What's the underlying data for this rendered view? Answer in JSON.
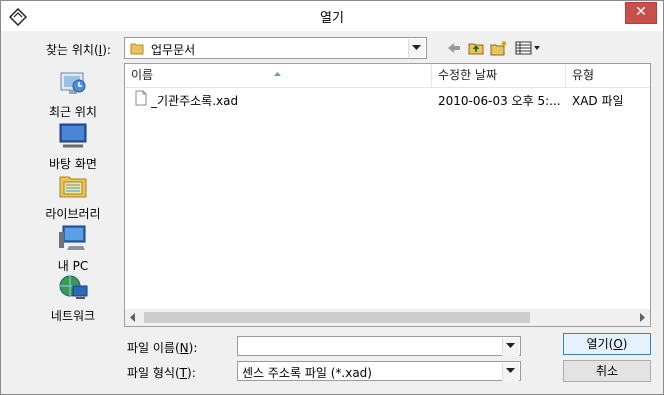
{
  "window": {
    "title": "열기"
  },
  "lookin": {
    "label": "찾는 위치(I):",
    "value": "업무문서"
  },
  "places": [
    {
      "label": "최근 위치"
    },
    {
      "label": "바탕 화면"
    },
    {
      "label": "라이브러리"
    },
    {
      "label": "내 PC"
    },
    {
      "label": "네트워크"
    }
  ],
  "columns": {
    "name": "이름",
    "modified": "수정한 날짜",
    "type": "유형"
  },
  "files": [
    {
      "name": "_기관주소록.xad",
      "modified": "2010-06-03 오후 5:...",
      "type": "XAD 파일"
    }
  ],
  "filename": {
    "label": "파일 이름(N):",
    "value": ""
  },
  "filetype": {
    "label": "파일 형식(T):",
    "value": "센스 주소록 파일 (*.xad)"
  },
  "buttons": {
    "open": "열기(O)",
    "cancel": "취소"
  },
  "colors": {
    "close": "#c7504a",
    "list_bg": "#ffffff",
    "window_bg": "#f0f0f0"
  }
}
